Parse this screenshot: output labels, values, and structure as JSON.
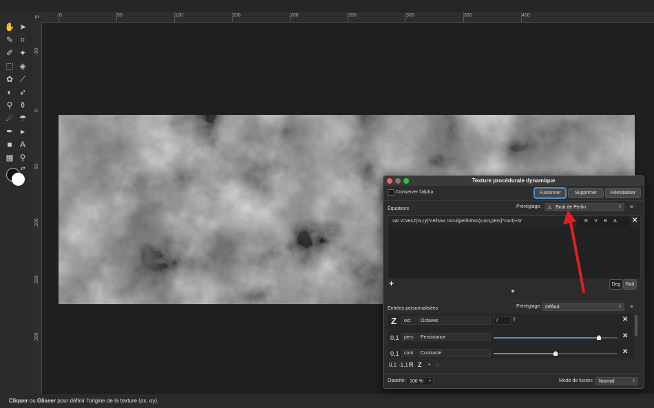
{
  "toolbar": {
    "tools": [
      {
        "name": "hand-tool-icon",
        "glyph": "✋"
      },
      {
        "name": "move-tool-icon",
        "glyph": "➤"
      },
      {
        "name": "color-picker-icon",
        "glyph": "✎"
      },
      {
        "name": "crop-tool-icon",
        "glyph": "⌗"
      },
      {
        "name": "paint-brush-icon",
        "glyph": "✐"
      },
      {
        "name": "magic-wand-icon",
        "glyph": "✦"
      },
      {
        "name": "marquee-select-icon",
        "glyph": "⬚"
      },
      {
        "name": "flood-fill-icon",
        "glyph": "◈"
      },
      {
        "name": "color-wheel-icon",
        "glyph": "✿"
      },
      {
        "name": "brush-icon",
        "glyph": "⟋"
      },
      {
        "name": "dodge-tool-icon",
        "glyph": "◐"
      },
      {
        "name": "rocket-tool-icon",
        "glyph": "➶"
      },
      {
        "name": "zoom-tool-icon",
        "glyph": "⚲"
      },
      {
        "name": "stamp-tool-icon",
        "glyph": "⚱"
      },
      {
        "name": "smudge-tool-icon",
        "glyph": "☄"
      },
      {
        "name": "blur-tool-icon",
        "glyph": "☂"
      },
      {
        "name": "pen-tool-icon",
        "glyph": "✒"
      },
      {
        "name": "node-tool-icon",
        "glyph": "▸"
      },
      {
        "name": "rectangle-tool-icon",
        "glyph": "■"
      },
      {
        "name": "text-tool-icon",
        "glyph": "A"
      },
      {
        "name": "mesh-tool-icon",
        "glyph": "▦"
      },
      {
        "name": "view-zoom-icon",
        "glyph": "⚲"
      }
    ],
    "colors": {
      "primary": "#111111",
      "secondary": "#ffffff"
    }
  },
  "ruler": {
    "unit": "px",
    "top_ticks": [
      "0",
      "50",
      "100",
      "150",
      "200",
      "250",
      "300",
      "350",
      "400"
    ],
    "left_ticks": [
      "-50",
      "0",
      "50",
      "100",
      "150",
      "200"
    ]
  },
  "status": {
    "click": "Cliquer",
    "or": " ou ",
    "drag": "Glisser",
    "rest": " pour définir l'origine de la texture (ox, oy)."
  },
  "dialog": {
    "title": "Texture procédurale dynamique",
    "keep_alpha": "Conserver l'alpha",
    "merge": "Fusionner",
    "delete": "Supprimer",
    "reset": "Réinitialiser",
    "equations_label": "Équations",
    "preset_label": "Préréglage:",
    "preset_value": "Bruit de Perlin",
    "equation": "var v=vec2(rx,ry)*cells/w; tocui(perlinhsc(v,oct,pers)*cont)+br",
    "channels": [
      "R",
      "V",
      "B",
      "A"
    ],
    "add": "+",
    "deg": "Deg",
    "rad": "Rad",
    "custom_label": "Entrées personnalisées",
    "custom_preset_label": "Préréglage:",
    "custom_preset_value": "Défaut",
    "inputs": [
      {
        "type": "Z",
        "var": "oct",
        "name": "Octaves",
        "value": "7"
      },
      {
        "type": "0,1",
        "var": "pers",
        "name": "Persistance",
        "level": 0.85
      },
      {
        "type": "0,1",
        "var": "cont",
        "name": "Contraste",
        "level": 0.5
      }
    ],
    "type_buttons": [
      "0,1",
      "-1,1",
      "R",
      "Z"
    ],
    "opacity_label": "Opacité:",
    "opacity_value": "100 %",
    "blend_label": "Mode de fusion:",
    "blend_value": "Normal"
  },
  "annotation": {
    "color": "#e02020"
  }
}
